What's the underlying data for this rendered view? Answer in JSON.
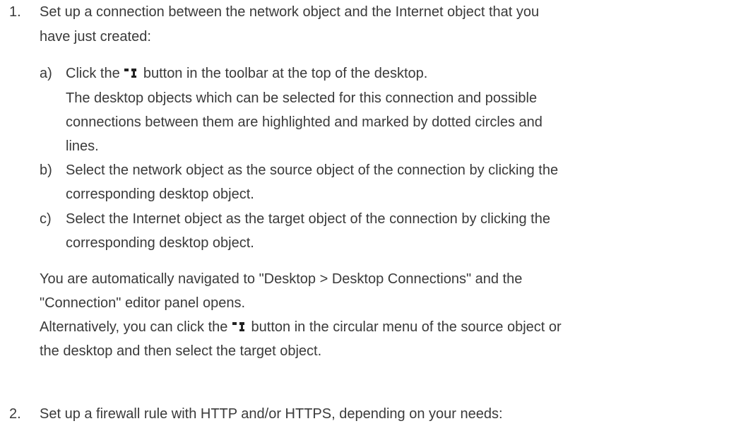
{
  "steps": [
    {
      "number": "1.",
      "intro_l1": "Set up a connection between the network object and the Internet object that you",
      "intro_l2": "have just created:",
      "substeps": [
        {
          "label": "a)",
          "l1_before": "Click the",
          "l1_after": "button in the toolbar at the top of the desktop.",
          "l2": "The desktop objects which can be selected for this connection and possible",
          "l3": "connections between them are highlighted and marked by dotted circles and",
          "l4": "lines."
        },
        {
          "label": "b)",
          "l1": "Select the network object as the source object of the connection by clicking the",
          "l2": "corresponding desktop object."
        },
        {
          "label": "c)",
          "l1": "Select the Internet object as the target object of the connection by clicking the",
          "l2": "corresponding desktop object."
        }
      ],
      "result_l1": "You are automatically navigated to \"Desktop > Desktop Connections\" and the",
      "result_l2": "\"Connection\" editor panel opens.",
      "alt_l1_before": "Alternatively, you can click the",
      "alt_l1_after": "button in the circular menu of the source object or",
      "alt_l2": "the desktop and then select the target object."
    },
    {
      "number": "2.",
      "intro_l1": "Set up a firewall rule with HTTP and/or HTTPS, depending on your needs:"
    }
  ],
  "icons": {
    "connection_tool": "connection-tool-icon"
  }
}
